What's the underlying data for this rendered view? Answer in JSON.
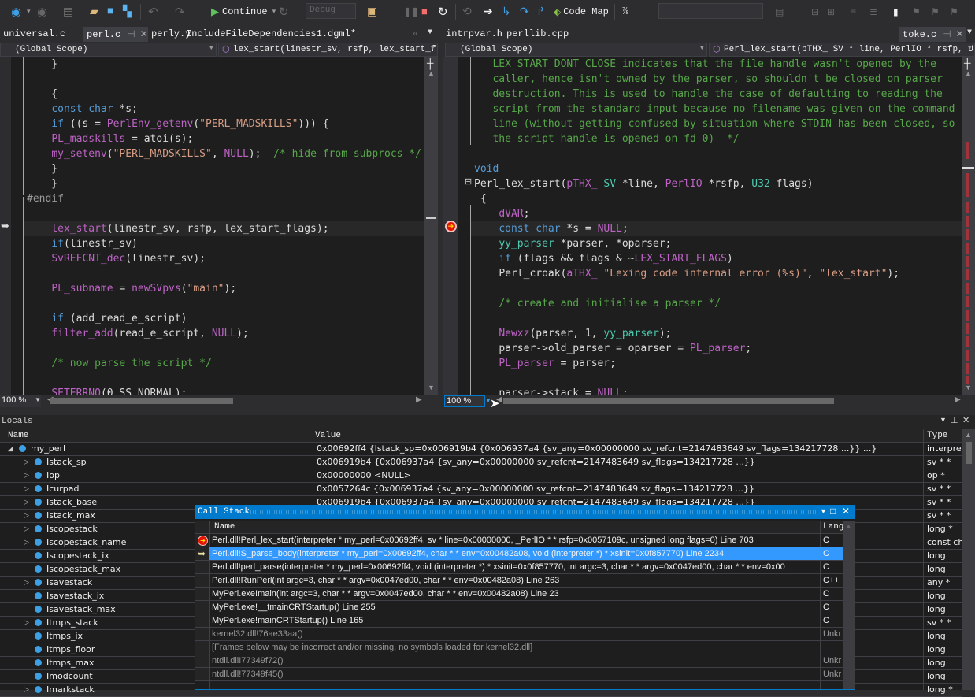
{
  "toolbar": {
    "continue_label": "Continue",
    "config_value": "Debug",
    "code_map_label": "Code Map",
    "search_value": ""
  },
  "left_tabs": [
    {
      "label": "universal.c",
      "active": false
    },
    {
      "label": "perl.c",
      "active": true
    },
    {
      "label": "perly.y",
      "active": false
    },
    {
      "label": "IncludeFileDependencies1.dgml*",
      "active": false
    }
  ],
  "right_tabs": [
    {
      "label": "intrpvar.h",
      "active": false
    },
    {
      "label": "perllib.cpp",
      "active": false
    },
    {
      "label": "toke.c",
      "active": true
    }
  ],
  "left_nav": {
    "scope": "(Global Scope)",
    "member": "lex_start(linestr_sv, rsfp, lex_start_fl&"
  },
  "right_nav": {
    "scope": "(Global Scope)",
    "member": "Perl_lex_start(pTHX_ SV * line, PerlIO * rsfp, U32"
  },
  "left_zoom": "100 %",
  "right_zoom": "100 %",
  "colors": {
    "keyword": "#569cd6",
    "macro": "#bd63c5",
    "string": "#d69d85",
    "comment": "#57a64a",
    "type": "#4ec9b0",
    "accent": "#007acc",
    "selection": "#3399ff"
  },
  "left_code": [
    [
      [
        "    }",
        "p"
      ]
    ],
    [],
    [
      [
        "    {",
        "p"
      ]
    ],
    [
      [
        "    ",
        "p"
      ],
      [
        "const",
        "k"
      ],
      [
        " ",
        "p"
      ],
      [
        "char",
        "k"
      ],
      [
        " *s;",
        "p"
      ]
    ],
    [
      [
        "    ",
        "p"
      ],
      [
        "if",
        "k"
      ],
      [
        " ((s = ",
        "p"
      ],
      [
        "PerlEnv_getenv",
        "m"
      ],
      [
        "(",
        "p"
      ],
      [
        "\"PERL_MADSKILLS\"",
        "s"
      ],
      [
        "))) {",
        "p"
      ]
    ],
    [
      [
        "    ",
        "p"
      ],
      [
        "PL_madskills",
        "m"
      ],
      [
        " = atoi(s);",
        "p"
      ]
    ],
    [
      [
        "    ",
        "p"
      ],
      [
        "my_setenv",
        "m"
      ],
      [
        "(",
        "p"
      ],
      [
        "\"PERL_MADSKILLS\"",
        "s"
      ],
      [
        ", ",
        "p"
      ],
      [
        "NULL",
        "m"
      ],
      [
        ");  ",
        "p"
      ],
      [
        "/* hide from subprocs */",
        "c"
      ]
    ],
    [
      [
        "    }",
        "p"
      ]
    ],
    [
      [
        "    }",
        "p"
      ]
    ],
    [
      [
        "#endif",
        "g"
      ]
    ],
    [],
    [
      [
        "    ",
        "p"
      ],
      [
        "lex_start",
        "m"
      ],
      [
        "(linestr_sv, rsfp, lex_start_flags);",
        "p"
      ]
    ],
    [
      [
        "    ",
        "p"
      ],
      [
        "if",
        "k"
      ],
      [
        "(linestr_sv)",
        "p"
      ]
    ],
    [
      [
        "    ",
        "p"
      ],
      [
        "SvREFCNT_dec",
        "m"
      ],
      [
        "(linestr_sv);",
        "p"
      ]
    ],
    [],
    [
      [
        "    ",
        "p"
      ],
      [
        "PL_subname",
        "m"
      ],
      [
        " = ",
        "p"
      ],
      [
        "newSVpvs",
        "m"
      ],
      [
        "(",
        "p"
      ],
      [
        "\"main\"",
        "s"
      ],
      [
        ");",
        "p"
      ]
    ],
    [],
    [
      [
        "    ",
        "p"
      ],
      [
        "if",
        "k"
      ],
      [
        " (add_read_e_script)",
        "p"
      ]
    ],
    [
      [
        "    ",
        "p"
      ],
      [
        "filter_add",
        "m"
      ],
      [
        "(read_e_script, ",
        "p"
      ],
      [
        "NULL",
        "m"
      ],
      [
        ");",
        "p"
      ]
    ],
    [],
    [
      [
        "    ",
        "p"
      ],
      [
        "/* now parse the script */",
        "c"
      ]
    ],
    [],
    [
      [
        "    ",
        "p"
      ],
      [
        "SETERRNO",
        "m"
      ],
      [
        "(0,SS_NORMAL);",
        "p"
      ]
    ]
  ],
  "right_code": [
    [
      [
        "   ",
        "p"
      ],
      [
        "LEX_START_DONT_CLOSE indicates that the file handle wasn't opened by the",
        "c"
      ]
    ],
    [
      [
        "   ",
        "p"
      ],
      [
        "caller, hence isn't owned by the parser, so shouldn't be closed on parser",
        "c"
      ]
    ],
    [
      [
        "   ",
        "p"
      ],
      [
        "destruction. This is used to handle the case of defaulting to reading the",
        "c"
      ]
    ],
    [
      [
        "   ",
        "p"
      ],
      [
        "script from the standard input because no filename was given on the command",
        "c"
      ]
    ],
    [
      [
        "   ",
        "p"
      ],
      [
        "line (without getting confused by situation where STDIN has been closed, so",
        "c"
      ]
    ],
    [
      [
        "   ",
        "p"
      ],
      [
        "the script handle is opened on fd 0)  */",
        "c"
      ]
    ],
    [],
    [
      [
        "void",
        "k"
      ]
    ],
    [
      [
        "Perl_lex_start(",
        "p"
      ],
      [
        "pTHX_",
        "m"
      ],
      [
        " ",
        "p"
      ],
      [
        "SV",
        "t"
      ],
      [
        " *line, ",
        "p"
      ],
      [
        "PerlIO",
        "m"
      ],
      [
        " *rsfp, ",
        "p"
      ],
      [
        "U32",
        "t"
      ],
      [
        " flags)",
        "p"
      ]
    ],
    [
      [
        " {",
        "p"
      ]
    ],
    [
      [
        "    ",
        "p"
      ],
      [
        "dVAR",
        "m"
      ],
      [
        ";",
        "p"
      ]
    ],
    [
      [
        "    ",
        "p"
      ],
      [
        "const",
        "k"
      ],
      [
        " ",
        "p"
      ],
      [
        "char",
        "k"
      ],
      [
        " *s = ",
        "p"
      ],
      [
        "NULL",
        "m"
      ],
      [
        ";",
        "p"
      ]
    ],
    [
      [
        "    ",
        "p"
      ],
      [
        "yy_parser",
        "t"
      ],
      [
        " *parser, *oparser;",
        "p"
      ]
    ],
    [
      [
        "    ",
        "p"
      ],
      [
        "if",
        "k"
      ],
      [
        " (flags && flags & ~",
        "p"
      ],
      [
        "LEX_START_FLAGS",
        "m"
      ],
      [
        ")",
        "p"
      ]
    ],
    [
      [
        "    ",
        "p"
      ],
      [
        "Perl_croak(",
        "p"
      ],
      [
        "aTHX_",
        "m"
      ],
      [
        " ",
        "p"
      ],
      [
        "\"Lexing code internal error (%s)\"",
        "s"
      ],
      [
        ", ",
        "p"
      ],
      [
        "\"lex_start\"",
        "s"
      ],
      [
        ");",
        "p"
      ]
    ],
    [],
    [
      [
        "    ",
        "p"
      ],
      [
        "/* create and initialise a parser */",
        "c"
      ]
    ],
    [],
    [
      [
        "    ",
        "p"
      ],
      [
        "Newxz",
        "m"
      ],
      [
        "(parser, 1, ",
        "p"
      ],
      [
        "yy_parser",
        "t"
      ],
      [
        ");",
        "p"
      ]
    ],
    [
      [
        "    ",
        "p"
      ],
      [
        "parser->old_parser = oparser = ",
        "p"
      ],
      [
        "PL_parser",
        "m"
      ],
      [
        ";",
        "p"
      ]
    ],
    [
      [
        "    ",
        "p"
      ],
      [
        "PL_parser",
        "m"
      ],
      [
        " = parser;",
        "p"
      ]
    ],
    [],
    [
      [
        "    ",
        "p"
      ],
      [
        "parser->stack = ",
        "p"
      ],
      [
        "NULL",
        "m"
      ],
      [
        ";",
        "p"
      ]
    ]
  ],
  "locals": {
    "title": "Locals",
    "columns": {
      "name": "Name",
      "value": "Value",
      "type": "Type"
    },
    "rows": [
      {
        "name": "my_perl",
        "level": 0,
        "expander": "expanded",
        "value": "0x00692ff4 {Istack_sp=0x006919b4 {0x006937a4 {sv_any=0x00000000 sv_refcnt=2147483649 sv_flags=134217728 ...}} ...}",
        "type": "interpret"
      },
      {
        "name": "Istack_sp",
        "level": 1,
        "expander": "collapsed",
        "value": "0x006919b4 {0x006937a4 {sv_any=0x00000000 sv_refcnt=2147483649 sv_flags=134217728 ...}}",
        "type": "sv * *"
      },
      {
        "name": "Iop",
        "level": 1,
        "expander": "collapsed",
        "value": "0x00000000 <NULL>",
        "type": "op *"
      },
      {
        "name": "Icurpad",
        "level": 1,
        "expander": "collapsed",
        "value": "0x0057264c {0x006937a4 {sv_any=0x00000000 sv_refcnt=2147483649 sv_flags=134217728 ...}}",
        "type": "sv * *"
      },
      {
        "name": "Istack_base",
        "level": 1,
        "expander": "collapsed",
        "value": "0x006919b4 {0x006937a4 {sv_any=0x00000000 sv_refcnt=2147483649 sv_flags=134217728 ...}}",
        "type": "sv * *"
      },
      {
        "name": "Istack_max",
        "level": 1,
        "expander": "collapsed",
        "value": "",
        "type": "sv * *"
      },
      {
        "name": "Iscopestack",
        "level": 1,
        "expander": "collapsed",
        "value": "",
        "type": "long *"
      },
      {
        "name": "Iscopestack_name",
        "level": 1,
        "expander": "collapsed",
        "value": "",
        "type": "const ch"
      },
      {
        "name": "Iscopestack_ix",
        "level": 1,
        "expander": "none",
        "value": "",
        "type": "long"
      },
      {
        "name": "Iscopestack_max",
        "level": 1,
        "expander": "none",
        "value": "",
        "type": "long"
      },
      {
        "name": "Isavestack",
        "level": 1,
        "expander": "collapsed",
        "value": "",
        "type": "any *"
      },
      {
        "name": "Isavestack_ix",
        "level": 1,
        "expander": "none",
        "value": "",
        "type": "long"
      },
      {
        "name": "Isavestack_max",
        "level": 1,
        "expander": "none",
        "value": "",
        "type": "long"
      },
      {
        "name": "Itmps_stack",
        "level": 1,
        "expander": "collapsed",
        "value": "",
        "type": "sv * *"
      },
      {
        "name": "Itmps_ix",
        "level": 1,
        "expander": "none",
        "value": "",
        "type": "long"
      },
      {
        "name": "Itmps_floor",
        "level": 1,
        "expander": "none",
        "value": "",
        "type": "long"
      },
      {
        "name": "Itmps_max",
        "level": 1,
        "expander": "none",
        "value": "",
        "type": "long"
      },
      {
        "name": "Imodcount",
        "level": 1,
        "expander": "none",
        "value": "",
        "type": "long"
      },
      {
        "name": "Imarkstack",
        "level": 1,
        "expander": "collapsed",
        "value": "",
        "type": "long *"
      }
    ]
  },
  "callstack": {
    "title": "Call Stack",
    "columns": {
      "name": "Name",
      "lang": "Lang"
    },
    "rows": [
      {
        "marker": "current",
        "name": "Perl.dll!Perl_lex_start(interpreter * my_perl=0x00692ff4, sv * line=0x00000000, _PerlIO * * rsfp=0x0057109c, unsigned long flags=0) Line 703",
        "lang": "C",
        "dim": false
      },
      {
        "marker": "caller",
        "selected": true,
        "name": "Perl.dll!S_parse_body(interpreter * my_perl=0x00692ff4, char * * env=0x00482a08, void (interpreter *) * xsinit=0x0f857770) Line 2234",
        "lang": "C",
        "dim": false
      },
      {
        "name": "Perl.dll!perl_parse(interpreter * my_perl=0x00692ff4, void (interpreter *) * xsinit=0x0f857770, int argc=3, char * * argv=0x0047ed00, char * * env=0x00",
        "lang": "C",
        "dim": false
      },
      {
        "name": "Perl.dll!RunPerl(int argc=3, char * * argv=0x0047ed00, char * * env=0x00482a08) Line 263",
        "lang": "C++",
        "dim": false
      },
      {
        "name": "MyPerl.exe!main(int argc=3, char * * argv=0x0047ed00, char * * env=0x00482a08) Line 23",
        "lang": "C",
        "dim": false
      },
      {
        "name": "MyPerl.exe!__tmainCRTStartup() Line 255",
        "lang": "C",
        "dim": false
      },
      {
        "name": "MyPerl.exe!mainCRTStartup() Line 165",
        "lang": "C",
        "dim": false
      },
      {
        "name": "kernel32.dll!76ae33aa()",
        "lang": "Unkr",
        "dim": true
      },
      {
        "name": "[Frames below may be incorrect and/or missing, no symbols loaded for kernel32.dll]",
        "lang": "",
        "dim": true
      },
      {
        "name": "ntdll.dll!77349f72()",
        "lang": "Unkr",
        "dim": true
      },
      {
        "name": "ntdll.dll!77349f45()",
        "lang": "Unkr",
        "dim": true
      }
    ]
  }
}
